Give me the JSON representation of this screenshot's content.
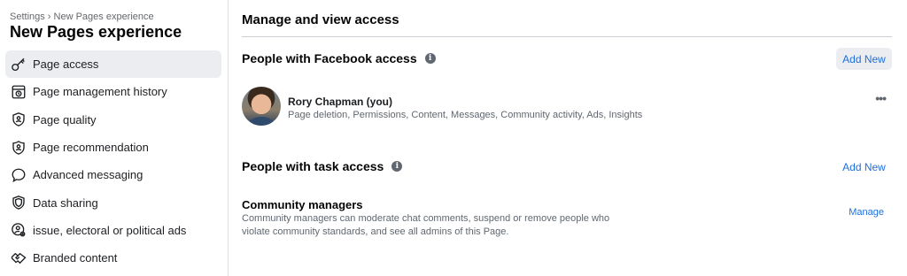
{
  "sidebar": {
    "breadcrumb": "Settings › New Pages experience",
    "title": "New Pages experience",
    "items": [
      {
        "label": "Page access",
        "icon": "key-icon",
        "active": true
      },
      {
        "label": "Page management history",
        "icon": "history-icon",
        "active": false
      },
      {
        "label": "Page quality",
        "icon": "shield-person-icon",
        "active": false
      },
      {
        "label": "Page recommendation",
        "icon": "shield-recommend-icon",
        "active": false
      },
      {
        "label": "Advanced messaging",
        "icon": "chat-bubble-icon",
        "active": false
      },
      {
        "label": "Data sharing",
        "icon": "shield-icon",
        "active": false
      },
      {
        "label": "issue, electoral or political ads",
        "icon": "person-gear-icon",
        "active": false
      },
      {
        "label": "Branded content",
        "icon": "handshake-icon",
        "active": false
      }
    ]
  },
  "main": {
    "title": "Manage and view access",
    "facebook_access": {
      "heading": "People with Facebook access",
      "add_label": "Add New",
      "person": {
        "name": "Rory Chapman (you)",
        "permissions": "Page deletion, Permissions, Content, Messages, Community activity, Ads, Insights"
      },
      "more_label": "•••"
    },
    "task_access": {
      "heading": "People with task access",
      "add_label": "Add New",
      "role_title": "Community managers",
      "role_desc": "Community managers can moderate chat comments, suspend or remove people who violate community standards, and see all admins of this Page.",
      "manage_label": "Manage"
    }
  },
  "colors": {
    "accent": "#216fdb",
    "active_bg": "#ebedf0",
    "secondary_text": "#606770"
  }
}
